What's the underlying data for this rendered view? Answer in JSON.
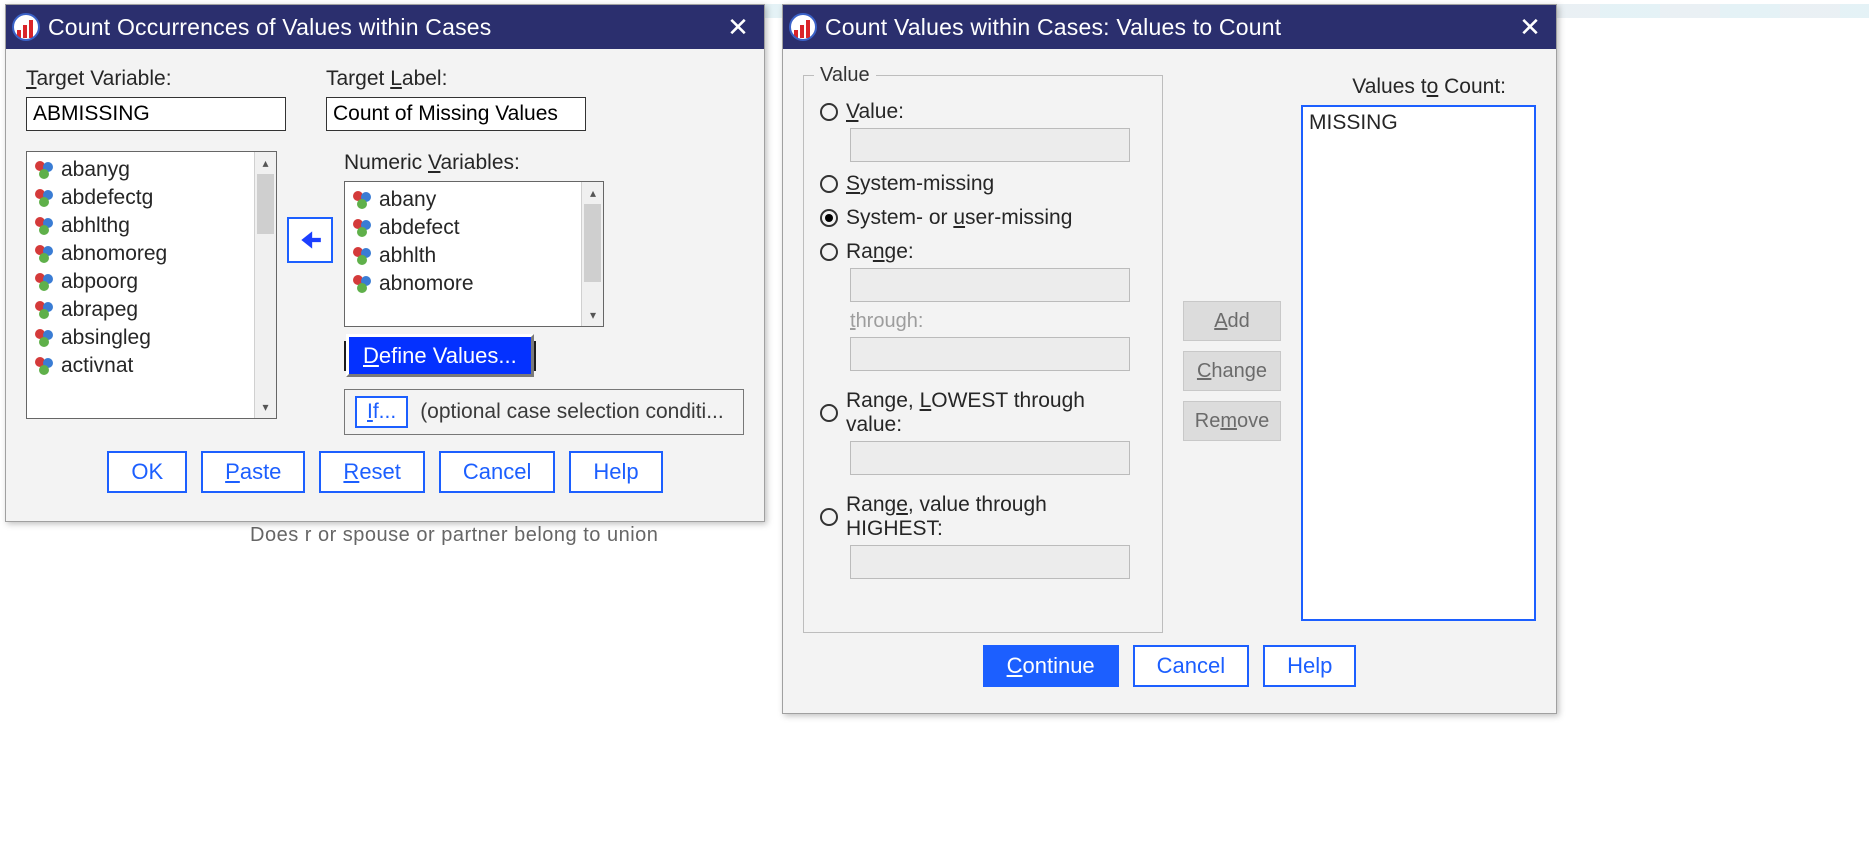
{
  "dialog1": {
    "title": "Count Occurrences of Values within Cases",
    "labels": {
      "target_variable": "Target Variable:",
      "target_label": "Target Label:",
      "numeric_variables": "Numeric Variables:"
    },
    "values": {
      "target_variable": "ABMISSING",
      "target_label": "Count of Missing Values "
    },
    "source_variables": [
      "abanyg",
      "abdefectg",
      "abhlthg",
      "abnomoreg",
      "abpoorg",
      "abrapeg",
      "absingleg",
      "activnat"
    ],
    "numeric_variables": [
      "abany",
      "abdefect",
      "abhlth",
      "abnomore"
    ],
    "buttons": {
      "define_values": "Define Values...",
      "if_button": "If...",
      "if_text": "(optional case selection conditi...",
      "ok": "OK",
      "paste": "Paste",
      "reset": "Reset",
      "cancel": "Cancel",
      "help": "Help"
    }
  },
  "dialog2": {
    "title": "Count Values within Cases: Values to Count",
    "fieldset_legend": "Value",
    "radios": {
      "value": "Value:",
      "system_missing": "System-missing",
      "system_or_user_missing": "System- or user-missing",
      "range": "Range:",
      "through": "through:",
      "range_lowest": "Range, LOWEST through value:",
      "range_highest": "Range, value through HIGHEST:"
    },
    "selected_radio": "system_or_user_missing",
    "mid_buttons": {
      "add": "Add",
      "change": "Change",
      "remove": "Remove"
    },
    "values_to_count_label": "Values to Count:",
    "values_to_count": [
      "MISSING"
    ],
    "buttons": {
      "continue": "Continue",
      "cancel": "Cancel",
      "help": "Help"
    }
  },
  "background_text": "Does r or spouse or partner belong to union"
}
